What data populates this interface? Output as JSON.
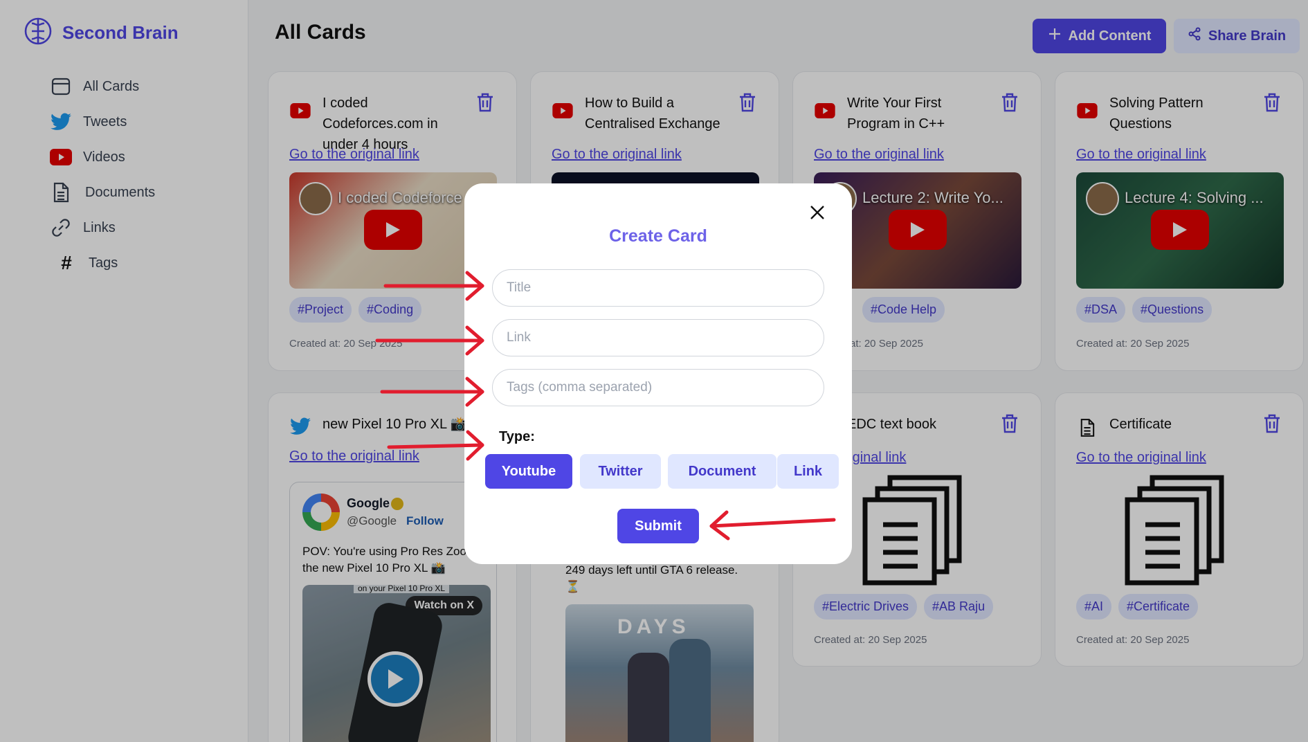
{
  "brand": {
    "name": "Second Brain",
    "icon": "brain-icon"
  },
  "sidebar": {
    "items": [
      {
        "label": "All Cards",
        "icon": "cards-icon"
      },
      {
        "label": "Tweets",
        "icon": "twitter-icon"
      },
      {
        "label": "Videos",
        "icon": "youtube-icon"
      },
      {
        "label": "Documents",
        "icon": "document-icon"
      },
      {
        "label": "Links",
        "icon": "link-icon"
      },
      {
        "label": "Tags",
        "icon": "hash-icon"
      }
    ]
  },
  "header": {
    "title": "All Cards",
    "add_label": "Add Content",
    "share_label": "Share Brain"
  },
  "cards": [
    {
      "type": "youtube",
      "title": "I coded Codeforces.com in under 4 hours",
      "link": "Go to the original link",
      "thumb_caption": "I coded Codeforce",
      "tags": [
        "#Project",
        "#Coding"
      ],
      "created": "Created at: 20 Sep 2025"
    },
    {
      "type": "youtube",
      "title": "How to Build a Centralised Exchange",
      "link": "Go to the original link",
      "thumb_caption": "",
      "tags": [],
      "created": ""
    },
    {
      "type": "youtube",
      "title": "Write Your First Program in C++",
      "link": "Go to the original link",
      "thumb_caption": "Lecture 2: Write Yo...",
      "tags": [
        "#Code Help"
      ],
      "created": "at: 20 Sep 2025"
    },
    {
      "type": "youtube",
      "title": "Solving Pattern Questions",
      "link": "Go to the original link",
      "thumb_caption": "Lecture 4: Solving ...",
      "tags": [
        "#DSA",
        "#Questions"
      ],
      "created": "Created at: 20 Sep 2025"
    },
    {
      "type": "twitter",
      "title": "new Pixel 10 Pro XL 📸",
      "link": "Go to the original link",
      "tweet_author": "Google",
      "tweet_handle": "@Google",
      "tweet_follow": "Follow",
      "tweet_text": "POV: You're using Pro Res Zoo on the new Pixel 10 Pro XL 📸",
      "tweet_overlay": "Watch on X",
      "tweet_banner": "on your Pixel 10 Pro XL"
    },
    {
      "type": "twitter",
      "title": "",
      "link": "",
      "tweet_text": "249 days left until GTA 6 release. ⏳",
      "tweet_image_text": "DAYS"
    },
    {
      "type": "document",
      "title": "EDC text book",
      "link": "the original link",
      "tags": [
        "#Electric Drives",
        "#AB Raju"
      ],
      "created": "Created at: 20 Sep 2025"
    },
    {
      "type": "document",
      "title": "Certificate",
      "link": "Go to the original link",
      "tags": [
        "#AI",
        "#Certificate"
      ],
      "created": "Created at: 20 Sep 2025"
    }
  ],
  "modal": {
    "title": "Create Card",
    "title_placeholder": "Title",
    "link_placeholder": "Link",
    "tags_placeholder": "Tags (comma separated)",
    "type_label": "Type:",
    "types": [
      "Youtube",
      "Twitter",
      "Document",
      "Link"
    ],
    "selected_type": "Youtube",
    "submit_label": "Submit"
  },
  "colors": {
    "accent": "#4f46e5",
    "accent_light": "#e0e7ff",
    "youtube": "#e60000",
    "twitter": "#1d9bf0",
    "annotation_arrow": "#e11d2e"
  }
}
